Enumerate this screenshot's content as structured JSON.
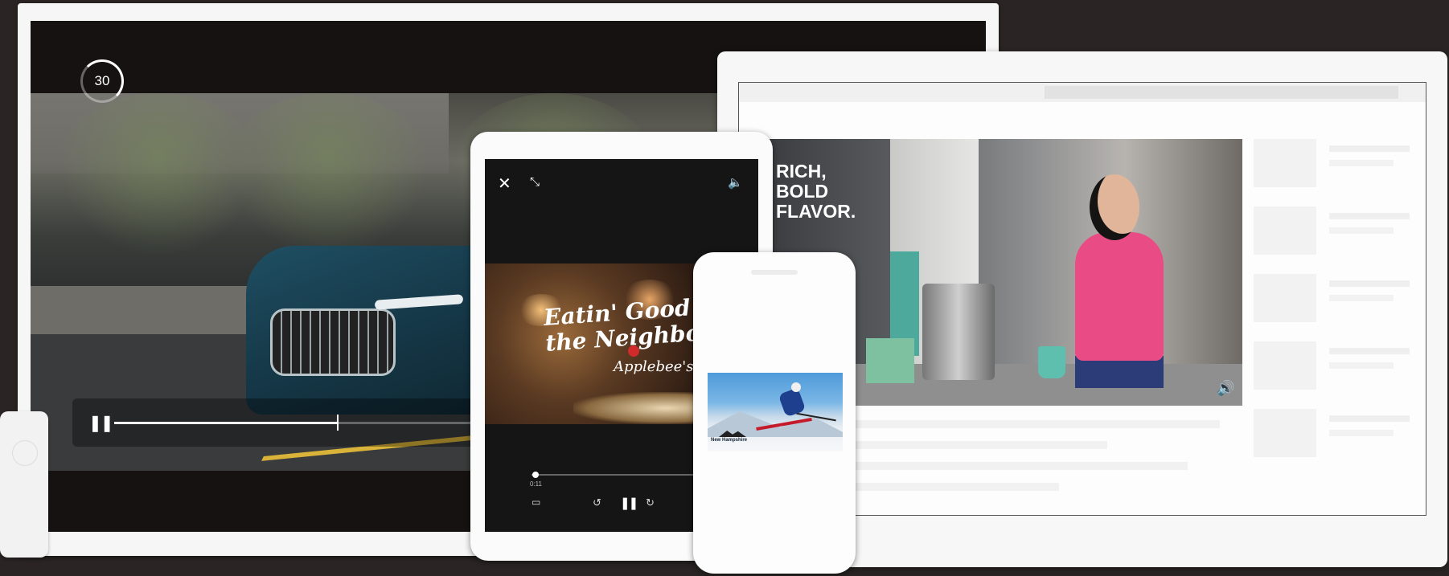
{
  "tv": {
    "countdown": "30",
    "pause_icon": "❚❚",
    "progress": 0.28
  },
  "laptop": {
    "headline": [
      "RICH,",
      "BOLD",
      "FLAVOR."
    ],
    "volume_icon": "🔊"
  },
  "tablet": {
    "close_icon": "✕",
    "shrink_icon": "⤡",
    "volume_icon": "🔈",
    "ad_text": [
      "Eatin' Good in",
      "the Neighborhood"
    ],
    "brand": "Applebee's",
    "time": "0:11",
    "airplay_icon": "▭",
    "rewind_icon": "↺",
    "pause_icon": "❚❚",
    "forward_icon": "↻",
    "progress": 0.02
  },
  "phone": {
    "logo_text": "New Hampshire"
  },
  "colors": {
    "tv_frame": "#f6f6f6",
    "laptop_frame": "#f7f7f7",
    "tablet_frame": "#fbfbfb",
    "phone_frame": "#fdfdfd",
    "shirt_pink": "#e94c84",
    "accent_teal": "#4ca99b"
  }
}
